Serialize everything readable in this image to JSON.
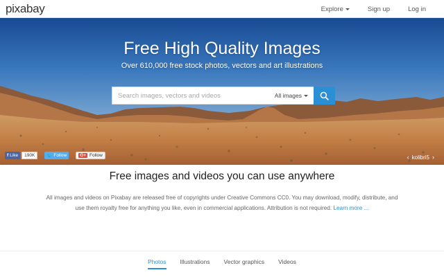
{
  "header": {
    "logo": "pixabay",
    "nav": [
      {
        "label": "Explore"
      },
      {
        "label": "Sign up"
      },
      {
        "label": "Log in"
      }
    ]
  },
  "hero": {
    "title": "Free High Quality Images",
    "subtitle": "Over 610,000 free stock photos, vectors and art illustrations",
    "search": {
      "placeholder": "Search images, vectors and videos",
      "type_selected": "All images"
    },
    "social": {
      "facebook_label": "Like",
      "facebook_count": "190K",
      "twitter_label": "Follow",
      "gplus_label": "Follow",
      "gplus_icon": "G+"
    },
    "credit": "kolibri5"
  },
  "intro": {
    "heading": "Free images and videos you can use anywhere",
    "text": "All images and videos on Pixabay are released free of copyrights under Creative Commons CC0. You may download, modify, distribute, and use them royalty free for anything you like, even in commercial applications. Attribution is not required.",
    "link": "Learn more ..."
  },
  "tabs": [
    {
      "label": "Photos",
      "active": true
    },
    {
      "label": "Illustrations",
      "active": false
    },
    {
      "label": "Vector graphics",
      "active": false
    },
    {
      "label": "Videos",
      "active": false
    }
  ],
  "colors": {
    "accent": "#2b8fd6",
    "facebook": "#4a66a0",
    "twitter": "#55acee"
  }
}
